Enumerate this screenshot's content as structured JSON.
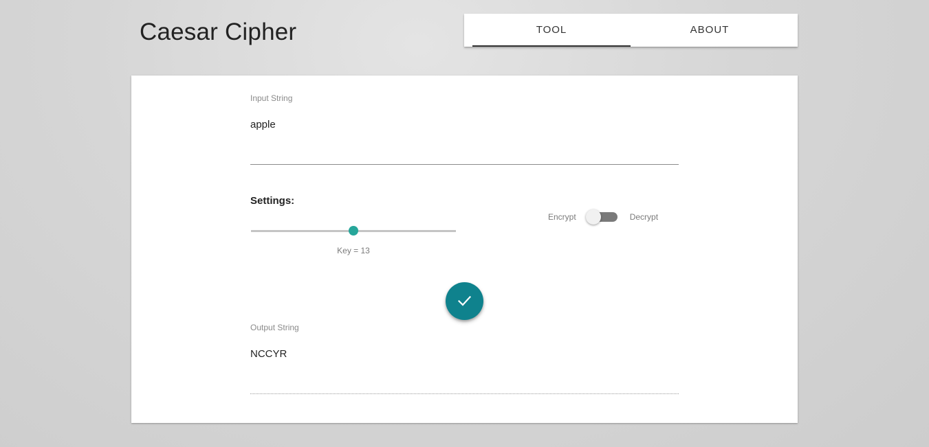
{
  "app": {
    "title": "Caesar Cipher"
  },
  "tabs": {
    "items": [
      {
        "label": "TOOL",
        "active": true
      },
      {
        "label": "ABOUT",
        "active": false
      }
    ]
  },
  "input": {
    "label": "Input String",
    "value": "apple"
  },
  "settings": {
    "label": "Settings:",
    "key": {
      "label": "Key = 13",
      "value": 13,
      "min": 0,
      "max": 26
    },
    "mode": {
      "off_label": "Encrypt",
      "on_label": "Decrypt",
      "decrypt_enabled": false
    }
  },
  "submit": {
    "icon": "check-icon"
  },
  "output": {
    "label": "Output String",
    "value": "NCCYR"
  },
  "colors": {
    "accent": "#26a69a",
    "fab": "#0f828d",
    "switch_track": "#7a7a7a"
  }
}
